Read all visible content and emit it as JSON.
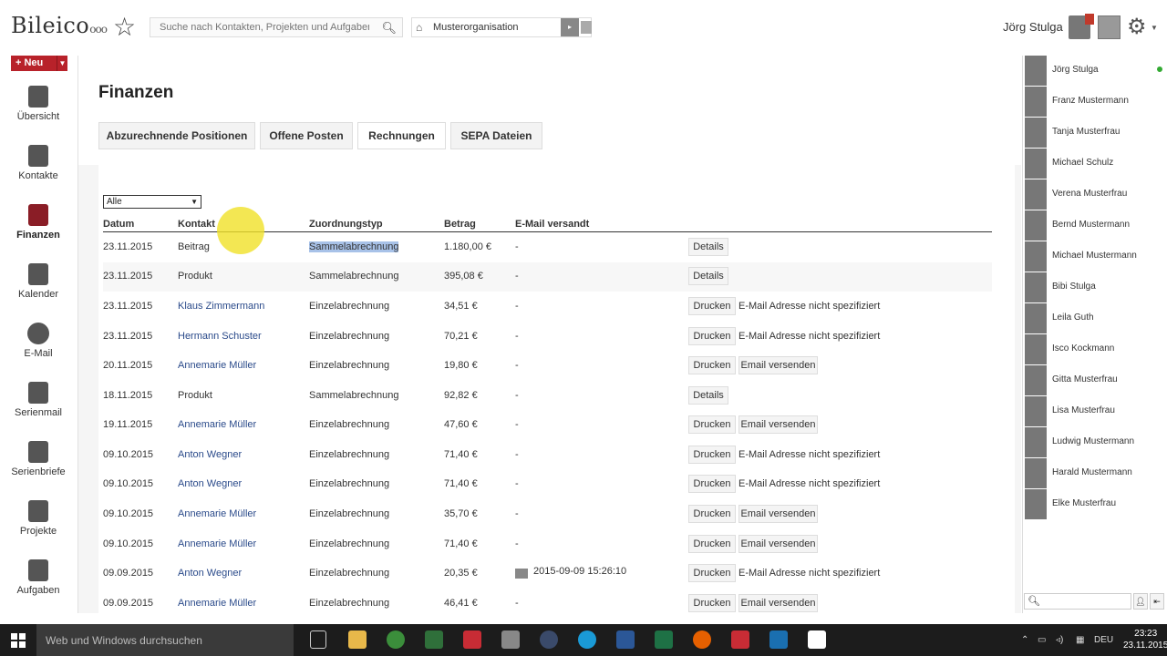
{
  "header": {
    "logo": "Bileico",
    "logo_suffix": "ooo",
    "search_placeholder": "Suche nach Kontakten, Projekten und Aufgaben",
    "organization": "Musterorganisation",
    "user_name": "Jörg Stulga"
  },
  "new_button": "+ Neu",
  "sidebar": {
    "items": [
      {
        "label": "Übersicht",
        "icon": "home-icon"
      },
      {
        "label": "Kontakte",
        "icon": "contacts-icon"
      },
      {
        "label": "Finanzen",
        "icon": "finance-icon",
        "active": true
      },
      {
        "label": "Kalender",
        "icon": "calendar-icon"
      },
      {
        "label": "E-Mail",
        "icon": "email-icon"
      },
      {
        "label": "Serienmail",
        "icon": "serienmail-icon"
      },
      {
        "label": "Serienbriefe",
        "icon": "serienbriefe-icon"
      },
      {
        "label": "Projekte",
        "icon": "projects-icon"
      },
      {
        "label": "Aufgaben",
        "icon": "tasks-icon"
      }
    ]
  },
  "page": {
    "title": "Finanzen",
    "tabs": [
      "Abzurechnende Positionen",
      "Offene Posten",
      "Rechnungen",
      "SEPA Dateien"
    ],
    "active_tab": "Rechnungen",
    "filter_value": "Alle",
    "columns": [
      "Datum",
      "Kontakt",
      "Zuordnungstyp",
      "Betrag",
      "E-Mail versandt"
    ],
    "rows": [
      {
        "date": "23.11.2015",
        "contact": "Beitrag",
        "contact_link": false,
        "type": "Sammelabrechnung",
        "amount": "1.180,00 €",
        "email": "-",
        "actions": [
          "Details"
        ],
        "note": ""
      },
      {
        "date": "23.11.2015",
        "contact": "Produkt",
        "contact_link": false,
        "type": "Sammelabrechnung",
        "amount": "395,08 €",
        "email": "-",
        "actions": [
          "Details"
        ],
        "note": ""
      },
      {
        "date": "23.11.2015",
        "contact": "Klaus Zimmermann",
        "contact_link": true,
        "type": "Einzelabrechnung",
        "amount": "34,51 €",
        "email": "-",
        "actions": [
          "Drucken"
        ],
        "note": "E-Mail Adresse nicht spezifiziert"
      },
      {
        "date": "23.11.2015",
        "contact": "Hermann Schuster",
        "contact_link": true,
        "type": "Einzelabrechnung",
        "amount": "70,21 €",
        "email": "-",
        "actions": [
          "Drucken"
        ],
        "note": "E-Mail Adresse nicht spezifiziert"
      },
      {
        "date": "20.11.2015",
        "contact": "Annemarie Müller",
        "contact_link": true,
        "type": "Einzelabrechnung",
        "amount": "19,80 €",
        "email": "-",
        "actions": [
          "Drucken",
          "Email versenden"
        ],
        "note": ""
      },
      {
        "date": "18.11.2015",
        "contact": "Produkt",
        "contact_link": false,
        "type": "Sammelabrechnung",
        "amount": "92,82 €",
        "email": "-",
        "actions": [
          "Details"
        ],
        "note": ""
      },
      {
        "date": "19.11.2015",
        "contact": "Annemarie Müller",
        "contact_link": true,
        "type": "Einzelabrechnung",
        "amount": "47,60 €",
        "email": "-",
        "actions": [
          "Drucken",
          "Email versenden"
        ],
        "note": ""
      },
      {
        "date": "09.10.2015",
        "contact": "Anton Wegner",
        "contact_link": true,
        "type": "Einzelabrechnung",
        "amount": "71,40 €",
        "email": "-",
        "actions": [
          "Drucken"
        ],
        "note": "E-Mail Adresse nicht spezifiziert"
      },
      {
        "date": "09.10.2015",
        "contact": "Anton Wegner",
        "contact_link": true,
        "type": "Einzelabrechnung",
        "amount": "71,40 €",
        "email": "-",
        "actions": [
          "Drucken"
        ],
        "note": "E-Mail Adresse nicht spezifiziert"
      },
      {
        "date": "09.10.2015",
        "contact": "Annemarie Müller",
        "contact_link": true,
        "type": "Einzelabrechnung",
        "amount": "35,70 €",
        "email": "-",
        "actions": [
          "Drucken",
          "Email versenden"
        ],
        "note": ""
      },
      {
        "date": "09.10.2015",
        "contact": "Annemarie Müller",
        "contact_link": true,
        "type": "Einzelabrechnung",
        "amount": "71,40 €",
        "email": "-",
        "actions": [
          "Drucken",
          "Email versenden"
        ],
        "note": ""
      },
      {
        "date": "09.09.2015",
        "contact": "Anton Wegner",
        "contact_link": true,
        "type": "Einzelabrechnung",
        "amount": "20,35 €",
        "email": "2015-09-09 15:26:10",
        "actions": [
          "Drucken"
        ],
        "note": "E-Mail Adresse nicht spezifiziert"
      },
      {
        "date": "09.09.2015",
        "contact": "Annemarie Müller",
        "contact_link": true,
        "type": "Einzelabrechnung",
        "amount": "46,41 €",
        "email": "-",
        "actions": [
          "Drucken",
          "Email versenden"
        ],
        "note": ""
      }
    ]
  },
  "contacts": [
    {
      "name": "Jörg Stulga",
      "online": true
    },
    {
      "name": "Franz Mustermann"
    },
    {
      "name": "Tanja Musterfrau"
    },
    {
      "name": "Michael Schulz"
    },
    {
      "name": "Verena Musterfrau"
    },
    {
      "name": "Bernd Mustermann"
    },
    {
      "name": "Michael Mustermann"
    },
    {
      "name": "Bibi Stulga"
    },
    {
      "name": "Leila Guth"
    },
    {
      "name": "Isco Kockmann"
    },
    {
      "name": "Gitta Musterfrau"
    },
    {
      "name": "Lisa Musterfrau"
    },
    {
      "name": "Ludwig Mustermann"
    },
    {
      "name": "Harald Mustermann"
    },
    {
      "name": "Elke Musterfrau"
    }
  ],
  "taskbar": {
    "search_text": "Web und Windows durchsuchen",
    "language": "DEU",
    "time": "23:23",
    "date": "23.11.2015"
  },
  "colors": {
    "brand_red": "#b8222a",
    "link_blue": "#2a4a8a",
    "highlight": "#a8c2e8",
    "taskbar": "#1c1c1c"
  }
}
